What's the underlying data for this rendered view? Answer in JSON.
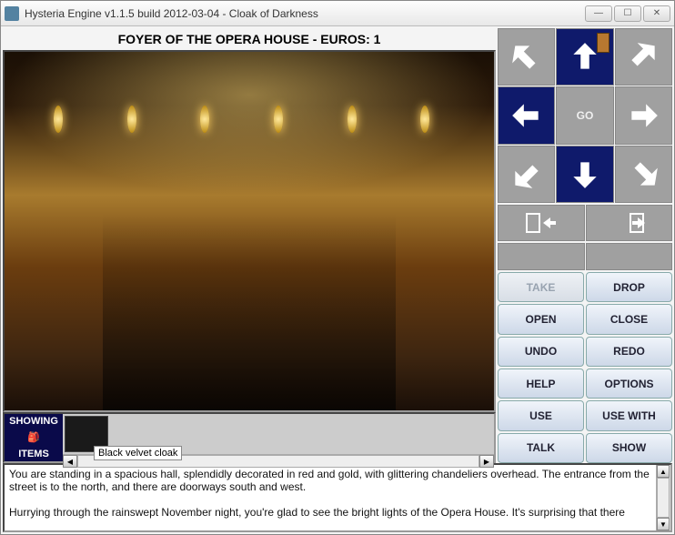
{
  "window": {
    "title": "Hysteria Engine v1.1.5 build 2012-03-04 - Cloak of Darkness"
  },
  "location_title": "FOYER OF THE OPERA HOUSE - EUROS: 1",
  "inventory": {
    "toggle_top": "SHOWING",
    "toggle_bottom": "ITEMS",
    "tooltip": "Black velvet cloak"
  },
  "nav": {
    "go_label": "GO",
    "directions": {
      "nw": {
        "active": false
      },
      "n": {
        "active": true,
        "door": true
      },
      "ne": {
        "active": false
      },
      "w": {
        "active": true
      },
      "e": {
        "active": false
      },
      "sw": {
        "active": false
      },
      "s": {
        "active": true
      },
      "se": {
        "active": false
      }
    }
  },
  "actions": [
    {
      "label": "TAKE",
      "disabled": true
    },
    {
      "label": "DROP",
      "disabled": false
    },
    {
      "label": "OPEN",
      "disabled": false
    },
    {
      "label": "CLOSE",
      "disabled": false
    },
    {
      "label": "UNDO",
      "disabled": false
    },
    {
      "label": "REDO",
      "disabled": false
    },
    {
      "label": "HELP",
      "disabled": false
    },
    {
      "label": "OPTIONS",
      "disabled": false
    },
    {
      "label": "USE",
      "disabled": false
    },
    {
      "label": "USE WITH",
      "disabled": false
    },
    {
      "label": "TALK",
      "disabled": false
    },
    {
      "label": "SHOW",
      "disabled": false
    }
  ],
  "narrative": "You are standing in a spacious hall, splendidly decorated in red and gold, with glittering chandeliers overhead. The entrance from the street is to the north, and there are doorways south and west.\n\nHurrying through the rainswept November night, you're glad to see the bright lights of the Opera House. It's surprising that there"
}
